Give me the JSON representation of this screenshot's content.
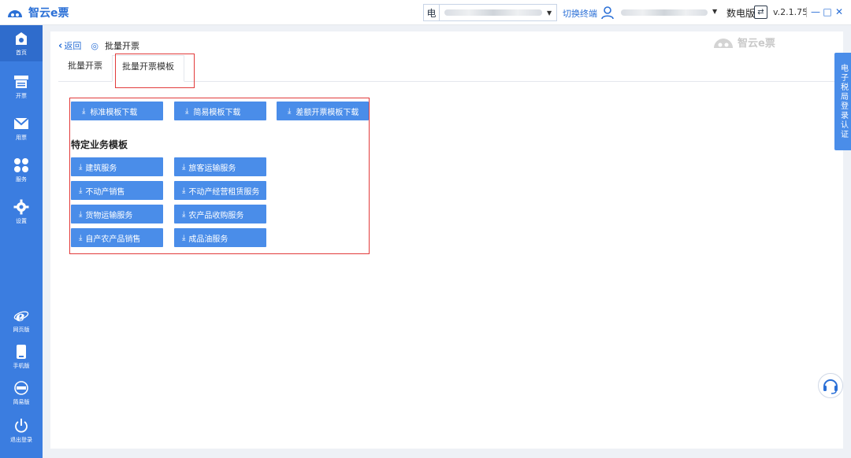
{
  "app": {
    "name": "智云e票",
    "version": "v.2.1.75",
    "edition": "数电版",
    "switch_link": "切换终端",
    "select_prefix": "电"
  },
  "sidebar": {
    "items": [
      {
        "label": "首页",
        "icon": "home-icon"
      },
      {
        "label": "开票",
        "icon": "invoice-printer-icon"
      },
      {
        "label": "用票",
        "icon": "mail-ticket-icon"
      },
      {
        "label": "服务",
        "icon": "apps-icon"
      },
      {
        "label": "设置",
        "icon": "gear-icon"
      }
    ],
    "bottom_items": [
      {
        "label": "网页版",
        "icon": "ie-browser-icon"
      },
      {
        "label": "手机版",
        "icon": "mobile-icon"
      },
      {
        "label": "简易版",
        "icon": "simple-mode-icon"
      },
      {
        "label": "退出登录",
        "icon": "power-icon"
      }
    ]
  },
  "breadcrumb": {
    "back": "返回",
    "title": "批量开票"
  },
  "watermark": "智云e票",
  "tabs": [
    {
      "label": "批量开票",
      "selected": false
    },
    {
      "label": "批量开票模板",
      "selected": true
    }
  ],
  "template_buttons": [
    "标准模板下载",
    "简易模板下载",
    "差额开票模板下载"
  ],
  "section_title": "特定业务模板",
  "business_buttons": [
    "建筑服务",
    "旅客运输服务",
    "不动产销售",
    "不动产经营租赁服务",
    "货物运输服务",
    "农产品收购服务",
    "自产农产品销售",
    "成品油服务"
  ],
  "right_tab": "电子税局登录认证",
  "colors": {
    "accent": "#3b7de0",
    "button": "#4a8de9",
    "highlight": "#e23b3b"
  }
}
